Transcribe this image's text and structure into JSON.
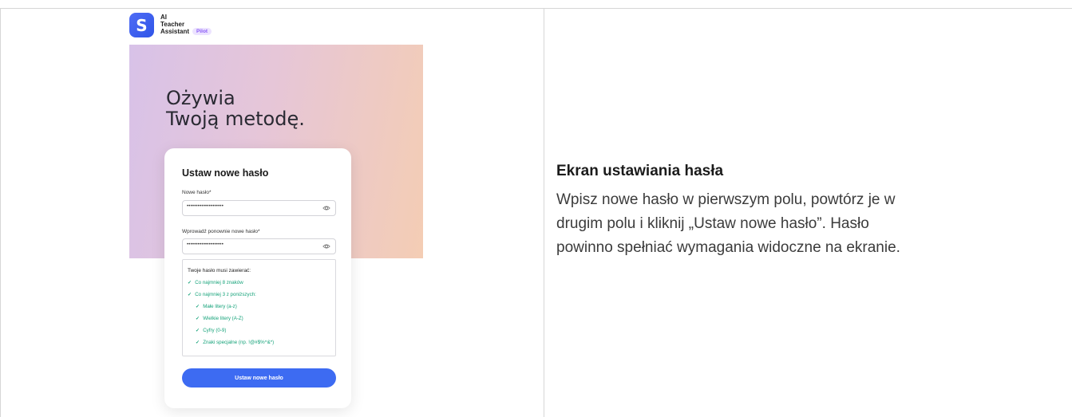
{
  "app": {
    "logo_letter": "S",
    "name_lines": [
      "AI",
      "Teacher",
      "Assistant"
    ],
    "badge": "Pilot"
  },
  "hero": {
    "title_lines": [
      "Ożywia",
      "Twoją metodę."
    ]
  },
  "form": {
    "title": "Ustaw nowe hasło",
    "new_password": {
      "label": "Nowe hasło*",
      "value": "••••••••••••••••••••"
    },
    "repeat_password": {
      "label": "Wprowadź ponownie nowe hasło*",
      "value": "••••••••••••••••••••"
    },
    "requirements": {
      "title": "Twoje hasło musi zawierać:",
      "items": [
        "Co najmniej 8 znaków",
        "Co najmniej 3 z poniższych:",
        "Małe litery (a-z)",
        "Wielkie litery (A-Z)",
        "Cyfry (0-9)",
        "Znaki specjalne (np. !@#$%^&*)"
      ],
      "check": "✓"
    },
    "submit_label": "Ustaw nowe hasło"
  },
  "doc": {
    "heading": "Ekran ustawiania hasła",
    "desc_lines": [
      "Wpisz nowe hasło w pierwszym polu, powtórz je w",
      "drugim polu i kliknij „Ustaw nowe hasło”. Hasło",
      "powinno spełniać wymagania widoczne na ekranie."
    ]
  },
  "colors": {
    "accent": "#3d6bf2",
    "success": "#16a37a",
    "badge_bg": "#ece3ff",
    "badge_text": "#8b5cf6"
  }
}
